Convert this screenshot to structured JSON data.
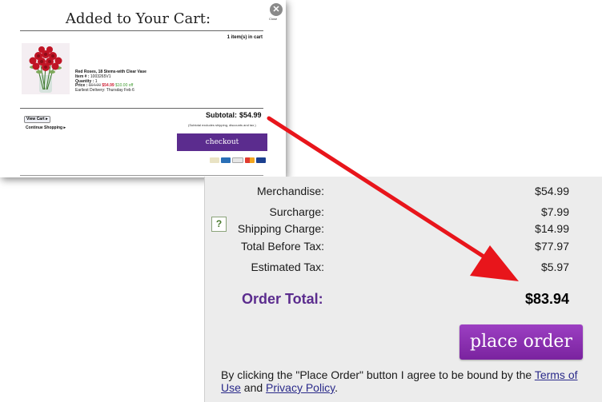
{
  "cart_popup": {
    "title": "Added to Your Cart:",
    "close_label": "Close",
    "items_count": "1 item(s) in cart",
    "product": {
      "name": "Red Roses, 18 Stems-with Clear Vase",
      "item_label": "Item # :",
      "item_number": "1003265V1",
      "quantity_label": "Quantity :",
      "quantity": "1",
      "price_label": "Price :",
      "price_original": "$64.99",
      "price_sale": "$54.99",
      "price_off": "$10.00 off",
      "delivery": "Earliest Delivery: Thursday Feb 6"
    },
    "subtotal_label": "Subtotal:",
    "subtotal_value": "$54.99",
    "subtotal_note": "(Subtotal excludes shipping, discounts and tax.)",
    "view_cart_label": "View Cart ▸",
    "continue_shopping": "Continue Shopping ▸",
    "checkout_label": "checkout"
  },
  "order_summary": {
    "rows": [
      {
        "label": "Merchandise:",
        "value": "$54.99"
      },
      {
        "label": "Surcharge:",
        "value": "$7.99"
      },
      {
        "label": "Shipping Charge:",
        "value": "$14.99"
      },
      {
        "label": "Total Before Tax:",
        "value": "$77.97"
      },
      {
        "label": "Estimated Tax:",
        "value": "$5.97"
      }
    ],
    "help_icon": "?",
    "order_total_label": "Order Total:",
    "order_total_value": "$83.94",
    "place_order_label": "place order",
    "terms_prefix": "By clicking the \"Place Order\" button I agree to be bound by the ",
    "terms_link": "Terms of Use",
    "terms_and": " and ",
    "privacy_link": "Privacy Policy",
    "terms_suffix": "."
  },
  "colors": {
    "brand_purple": "#5b2c8e",
    "arrow_red": "#e8151b"
  }
}
